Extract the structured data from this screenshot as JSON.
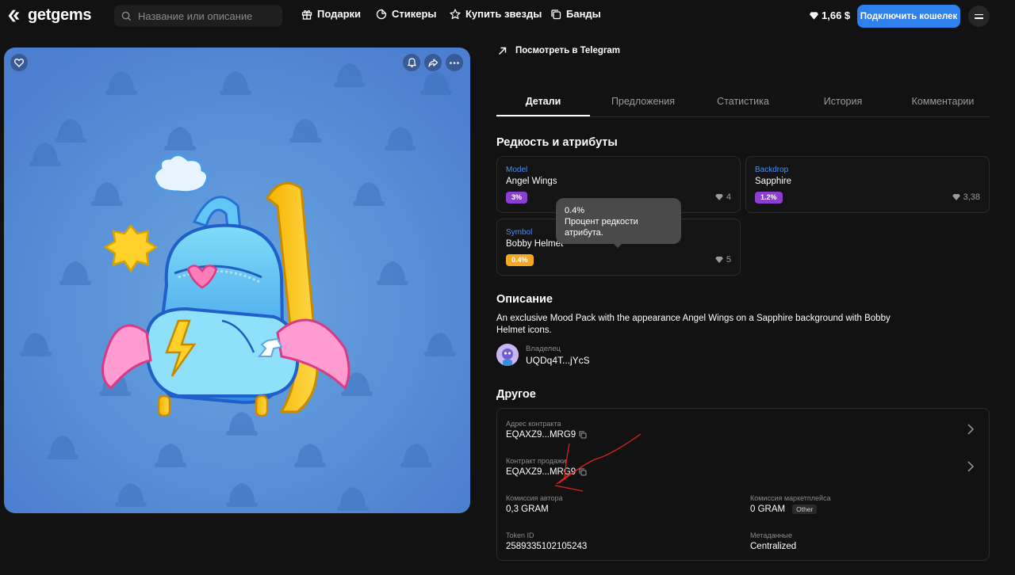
{
  "header": {
    "logo_text": "getgems",
    "search_placeholder": "Название или описание",
    "nav": [
      {
        "label": "Подарки",
        "icon": "gift-icon"
      },
      {
        "label": "Стикеры",
        "icon": "sticker-icon"
      },
      {
        "label": "Купить звезды",
        "icon": "star-icon"
      },
      {
        "label": "Банды",
        "icon": "bundle-icon"
      }
    ],
    "balance": "1,66 $",
    "connect_label": "Подключить кошелек"
  },
  "view_telegram": "Посмотреть в Telegram",
  "tabs": [
    {
      "label": "Детали",
      "active": true
    },
    {
      "label": "Предложения",
      "active": false
    },
    {
      "label": "Статистика",
      "active": false
    },
    {
      "label": "История",
      "active": false
    },
    {
      "label": "Комментарии",
      "active": false
    }
  ],
  "rarity": {
    "title": "Редкость и атрибуты",
    "attributes": [
      {
        "type": "Model",
        "value": "Angel Wings",
        "badge": "3%",
        "badge_color": "#8a3fd1",
        "count": "4"
      },
      {
        "type": "Backdrop",
        "value": "Sapphire",
        "badge": "1.2%",
        "badge_color": "#8a3fd1",
        "count": "3,38"
      },
      {
        "type": "Symbol",
        "value": "Bobby Helmet",
        "badge": "0.4%",
        "badge_color": "#f5a623",
        "count": "5"
      }
    ],
    "tooltip": {
      "value": "0.4%",
      "text": "Процент редкости атрибута."
    }
  },
  "description": {
    "title": "Описание",
    "text": "An exclusive Mood Pack with the appearance Angel Wings on a Sapphire background with Bobby Helmet icons.",
    "owner_label": "Владелец",
    "owner_address": "UQDq4T...jYcS"
  },
  "other": {
    "title": "Другое",
    "contract_label": "Адрес контракта",
    "contract_value": "EQAXZ9...MRG9",
    "sale_label": "Контракт продажи",
    "sale_value": "EQAXZ9...MRG9",
    "author_fee_label": "Комиссия автора",
    "author_fee_value": "0,3 GRAM",
    "market_fee_label": "Комиссия маркетплейса",
    "market_fee_value": "0 GRAM",
    "market_fee_tag": "Other",
    "token_label": "Token ID",
    "token_value": "2589335102105243",
    "metadata_label": "Метаданные",
    "metadata_value": "Centralized"
  },
  "colors": {
    "accent": "#2f80ed",
    "link_blue": "#4b8df8",
    "art_bg": "#5a8fd6"
  }
}
